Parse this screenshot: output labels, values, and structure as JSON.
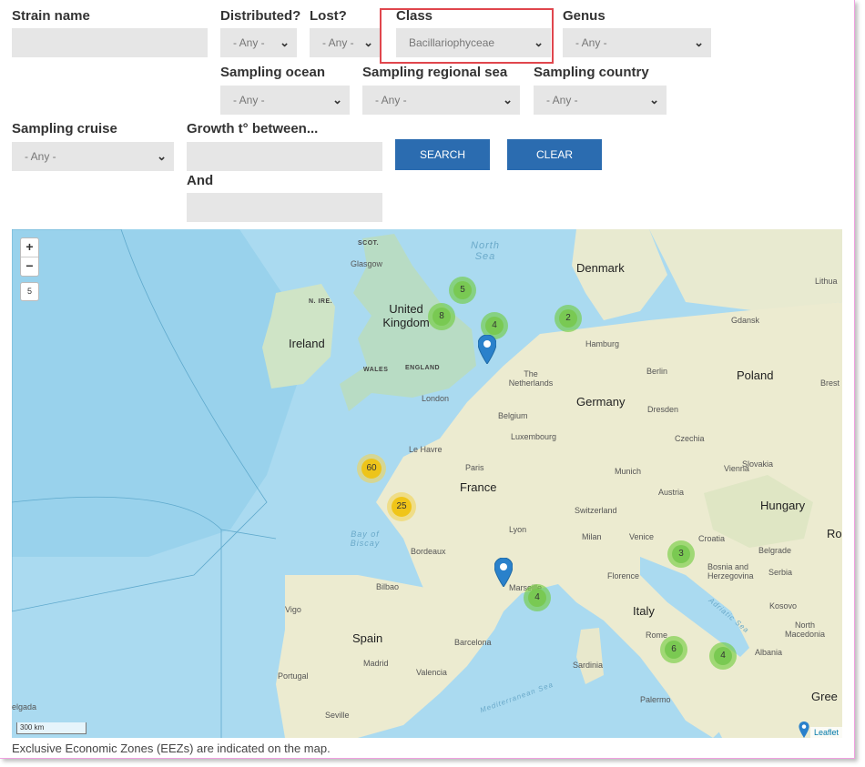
{
  "filters": {
    "strain_name": {
      "label": "Strain name",
      "value": ""
    },
    "distributed": {
      "label": "Distributed?",
      "value": "- Any -"
    },
    "lost": {
      "label": "Lost?",
      "value": "- Any -"
    },
    "class": {
      "label": "Class",
      "value": "Bacillariophyceae"
    },
    "genus": {
      "label": "Genus",
      "value": "- Any -"
    },
    "sampling_ocean": {
      "label": "Sampling ocean",
      "value": "- Any -"
    },
    "sampling_regional_sea": {
      "label": "Sampling regional sea",
      "value": "- Any -"
    },
    "sampling_country": {
      "label": "Sampling country",
      "value": "- Any -"
    },
    "sampling_cruise": {
      "label": "Sampling cruise",
      "value": "- Any -"
    },
    "growth_between": {
      "label": "Growth t° between...",
      "value": ""
    },
    "growth_and": {
      "label": "And",
      "value": ""
    }
  },
  "buttons": {
    "search": "SEARCH",
    "clear": "CLEAR"
  },
  "map": {
    "zoom_in": "+",
    "zoom_out": "−",
    "zoom_level": "5",
    "scale_label": "300 km",
    "attribution": "Leaflet",
    "clusters": [
      {
        "count": "5",
        "color": "green"
      },
      {
        "count": "8",
        "color": "green"
      },
      {
        "count": "4",
        "color": "green"
      },
      {
        "count": "2",
        "color": "green"
      },
      {
        "count": "60",
        "color": "yellow"
      },
      {
        "count": "25",
        "color": "yellow"
      },
      {
        "count": "3",
        "color": "green"
      },
      {
        "count": "4",
        "color": "green"
      },
      {
        "count": "6",
        "color": "green"
      },
      {
        "count": "4",
        "color": "green"
      }
    ],
    "labels": {
      "scot": "SCOT.",
      "glasgow": "Glasgow",
      "n_ire": "N. IRE.",
      "united_kingdom": "United Kingdom",
      "ireland": "Ireland",
      "wales": "WALES",
      "england": "ENGLAND",
      "london": "London",
      "north_sea": "North Sea",
      "denmark": "Denmark",
      "hamburg": "Hamburg",
      "gdansk": "Gdansk",
      "lithuania": "Lithua",
      "the_netherlands": "The Netherlands",
      "berlin": "Berlin",
      "poland": "Poland",
      "brest": "Brest",
      "belgium": "Belgium",
      "germany": "Germany",
      "dresden": "Dresden",
      "luxembourg": "Luxembourg",
      "czechia": "Czechia",
      "le_havre": "Le Havre",
      "paris": "Paris",
      "munich": "Munich",
      "vienna": "Vienna",
      "slovakia": "Slovakia",
      "france": "France",
      "austria": "Austria",
      "hungary": "Hungary",
      "switzerland": "Switzerland",
      "bay_of_biscay": "Bay of Biscay",
      "lyon": "Lyon",
      "milan": "Milan",
      "venice": "Venice",
      "croatia": "Croatia",
      "belgrade": "Belgrade",
      "bordeaux": "Bordeaux",
      "bosnia": "Bosnia and Herzegovina",
      "serbia": "Serbia",
      "ro": "Ro",
      "florence": "Florence",
      "bilbao": "Bilbao",
      "marseille": "Marseille",
      "vigo": "Vigo",
      "italy": "Italy",
      "kosovo": "Kosovo",
      "north_macedonia": "North Macedonia",
      "spain": "Spain",
      "barcelona": "Barcelona",
      "rome": "Rome",
      "albania": "Albania",
      "portugal": "Portugal",
      "madrid": "Madrid",
      "valencia": "Valencia",
      "sardinia": "Sardinia",
      "lisbon_partial": "elgada",
      "seville": "Seville",
      "palermo": "Palermo",
      "greece_partial": "Gree",
      "mediterranean": "Mediterranean Sea",
      "adriatic": "Adriatic Sea"
    }
  },
  "footer": "Exclusive Economic Zones (EEZs) are indicated on the map."
}
